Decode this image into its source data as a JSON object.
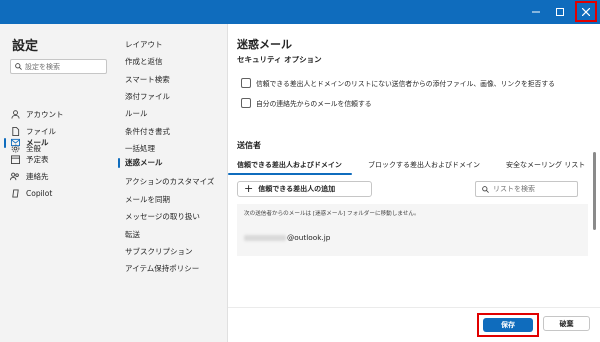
{
  "window": {
    "min_icon": "minimize-icon",
    "max_icon": "maximize-icon",
    "close_icon": "close-icon",
    "highlight_color": "#e00000",
    "accent": "#0f6cbd"
  },
  "nav1": {
    "title": "設定",
    "search_placeholder": "設定を検索",
    "items": [
      {
        "label": "アカウント",
        "icon": "person-icon"
      },
      {
        "label": "ファイル",
        "icon": "file-icon"
      },
      {
        "label": "全般",
        "icon": "gear-icon"
      },
      {
        "label": "メール",
        "icon": "mail-icon",
        "selected": true
      },
      {
        "label": "予定表",
        "icon": "calendar-icon"
      },
      {
        "label": "連絡先",
        "icon": "people-icon"
      },
      {
        "label": "Copilot",
        "icon": "copilot-icon"
      }
    ]
  },
  "nav2": {
    "items": [
      {
        "label": "レイアウト"
      },
      {
        "label": "作成と返信"
      },
      {
        "label": "スマート検索"
      },
      {
        "label": "添付ファイル"
      },
      {
        "label": "ルール"
      },
      {
        "label": "条件付き書式"
      },
      {
        "label": "一括処理"
      },
      {
        "label": "迷惑メール",
        "selected": true
      },
      {
        "label": "アクションのカスタマイズ"
      },
      {
        "label": "メールを同期"
      },
      {
        "label": "メッセージの取り扱い"
      },
      {
        "label": "転送"
      },
      {
        "label": "サブスクリプション"
      },
      {
        "label": "アイテム保持ポリシー"
      }
    ]
  },
  "content": {
    "title": "迷惑メール",
    "section_cut": "セキュリティ オプション",
    "checkboxes": [
      {
        "label": "信頼できる差出人とドメインのリストにない送信者からの添付ファイル、画像、リンクを拒否する",
        "checked": false
      },
      {
        "label": "自分の連絡先からのメールを信頼する",
        "checked": false
      }
    ],
    "senders_title": "送信者",
    "tabs": [
      {
        "label": "信頼できる差出人およびドメイン",
        "selected": true
      },
      {
        "label": "ブロックする差出人およびドメイン"
      },
      {
        "label": "安全なメーリング リスト"
      }
    ],
    "add_button": "信頼できる差出人の追加",
    "list_search_placeholder": "リストを検索",
    "list_note": "次の送信者からのメールは [迷惑メール] フォルダーに移動しません。",
    "entry_domain": "@outlook.jp"
  },
  "footer": {
    "save": "保存",
    "discard": "破棄"
  }
}
